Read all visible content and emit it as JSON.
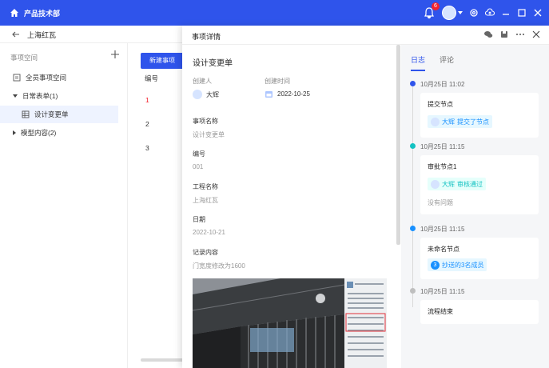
{
  "titlebar": {
    "title": "产品技术部",
    "notification_count": "6",
    "colors": {
      "brand": "#2f54eb"
    }
  },
  "subbar": {
    "project": "上海红瓦"
  },
  "sidebar": {
    "space_title": "事项空间",
    "items": [
      {
        "label": "全员事项空间",
        "icon": "list-icon"
      },
      {
        "label": "日常表单(1)",
        "expanded": true
      },
      {
        "label": "设计变更单",
        "icon": "table-icon",
        "active": true
      },
      {
        "label": "模型内容(2)",
        "expanded": false
      }
    ]
  },
  "middle": {
    "new_button": "新建事项",
    "column_header": "编号",
    "rows": [
      "1",
      "2",
      "3"
    ]
  },
  "panel": {
    "title": "事项详情",
    "doc_title": "设计变更单",
    "creator_label": "创建人",
    "creator": "大辉",
    "created_label": "创建时间",
    "created": "2022-10-25",
    "fields": [
      {
        "label": "事项名称",
        "value": "设计变更单"
      },
      {
        "label": "编号",
        "value": "001"
      },
      {
        "label": "工程名称",
        "value": "上海红瓦"
      },
      {
        "label": "日期",
        "value": "2022-10-21"
      },
      {
        "label": "记录内容",
        "value": "门宽度修改为1600"
      }
    ]
  },
  "log": {
    "tabs": [
      "日志",
      "评论"
    ],
    "active_tab": "日志",
    "entries": [
      {
        "time": "10月25日 11:02",
        "node": "提交节点",
        "actor": "大辉",
        "action": "提交了节点",
        "color": "#2f54eb"
      },
      {
        "time": "10月25日 11:15",
        "node": "审批节点1",
        "actor": "大辉",
        "action": "审核通过",
        "comment": "没有问题",
        "color": "#13c2c2"
      },
      {
        "time": "10月25日 11:15",
        "node": "未命名节点",
        "count": "3",
        "action": "抄送的3名成员",
        "color": "#1890ff"
      },
      {
        "time": "10月25日 11:15",
        "node": "流程结束",
        "color": "#bfbfbf"
      }
    ]
  }
}
